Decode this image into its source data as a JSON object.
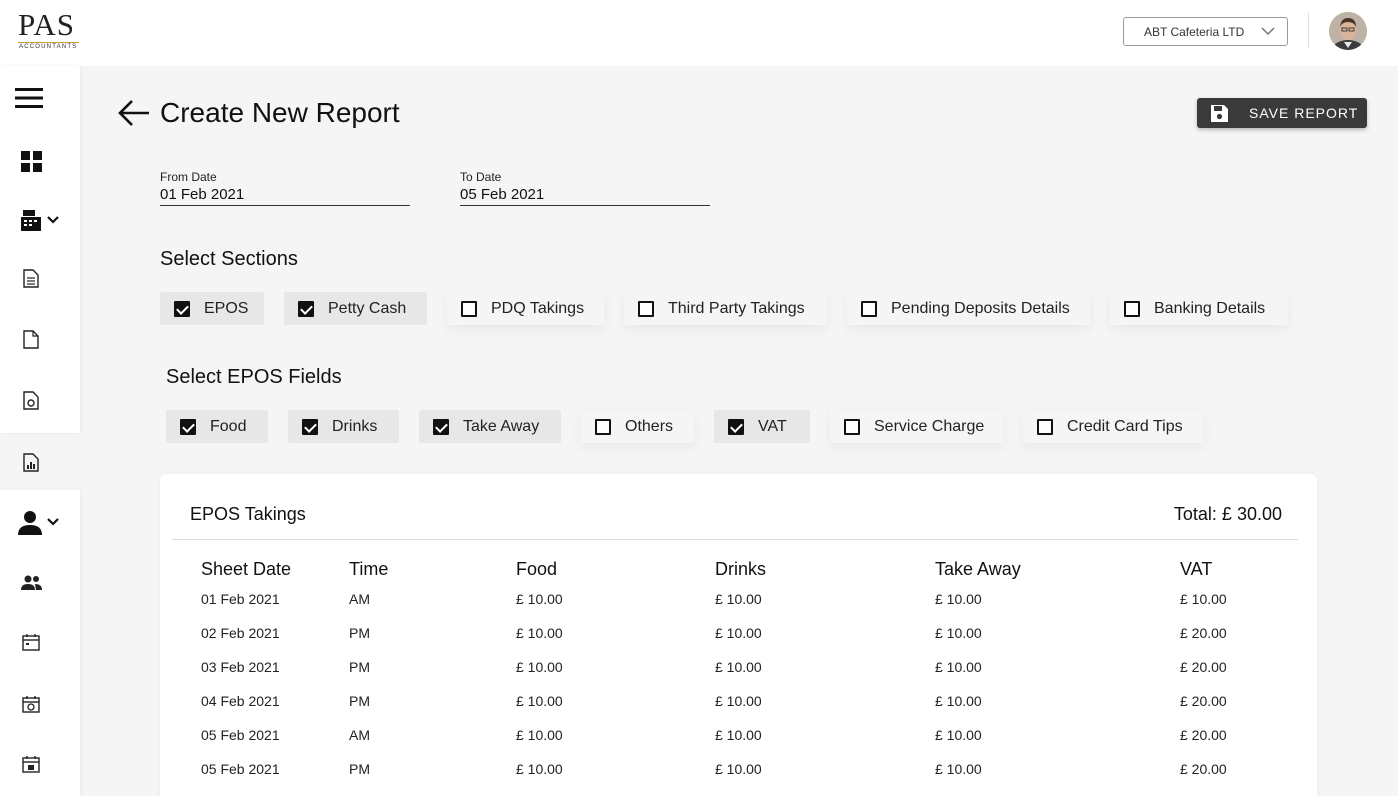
{
  "header": {
    "logo_text": "PAS",
    "logo_subtext": "ACCOUNTANTS",
    "company_select": "ABT Cafeteria LTD"
  },
  "page": {
    "title": "Create New Report",
    "save_label": "SAVE REPORT"
  },
  "dates": {
    "from_label": "From Date",
    "from_value": "01 Feb 2021",
    "to_label": "To Date",
    "to_value": "05 Feb 2021"
  },
  "sections": {
    "title": "Select Sections",
    "items": [
      {
        "label": "EPOS",
        "checked": true
      },
      {
        "label": "Petty Cash",
        "checked": true
      },
      {
        "label": "PDQ Takings",
        "checked": false
      },
      {
        "label": "Third Party Takings",
        "checked": false
      },
      {
        "label": "Pending Deposits Details",
        "checked": false
      },
      {
        "label": "Banking Details",
        "checked": false
      }
    ]
  },
  "epos_fields": {
    "title": "Select EPOS Fields",
    "items": [
      {
        "label": "Food",
        "checked": true
      },
      {
        "label": "Drinks",
        "checked": true
      },
      {
        "label": "Take Away",
        "checked": true
      },
      {
        "label": "Others",
        "checked": false
      },
      {
        "label": "VAT",
        "checked": true
      },
      {
        "label": "Service Charge",
        "checked": false
      },
      {
        "label": "Credit Card Tips",
        "checked": false
      }
    ]
  },
  "table": {
    "title": "EPOS Takings",
    "total": "Total: £ 30.00",
    "columns": [
      "Sheet Date",
      "Time",
      "Food",
      "Drinks",
      "Take Away",
      "VAT"
    ],
    "rows": [
      [
        "01 Feb 2021",
        "AM",
        "£ 10.00",
        "£ 10.00",
        "£ 10.00",
        "£ 10.00"
      ],
      [
        "02 Feb 2021",
        "PM",
        "£ 10.00",
        "£ 10.00",
        "£ 10.00",
        "£ 20.00"
      ],
      [
        "03 Feb 2021",
        "PM",
        "£ 10.00",
        "£ 10.00",
        "£ 10.00",
        "£ 20.00"
      ],
      [
        "04 Feb 2021",
        "PM",
        "£ 10.00",
        "£ 10.00",
        "£ 10.00",
        "£ 20.00"
      ],
      [
        "05 Feb 2021",
        "AM",
        "£ 10.00",
        "£ 10.00",
        "£ 10.00",
        "£ 20.00"
      ],
      [
        "05 Feb 2021",
        "PM",
        "£ 10.00",
        "£ 10.00",
        "£ 10.00",
        "£ 20.00"
      ]
    ]
  },
  "sidebar_icons": [
    "menu-icon",
    "dashboard-icon",
    "cash-register-icon",
    "document-icon",
    "file-icon",
    "file-settings-icon",
    "report-icon",
    "user-icon",
    "users-icon",
    "calendar-icon",
    "calendar-clock-icon",
    "calendar-edit-icon"
  ]
}
